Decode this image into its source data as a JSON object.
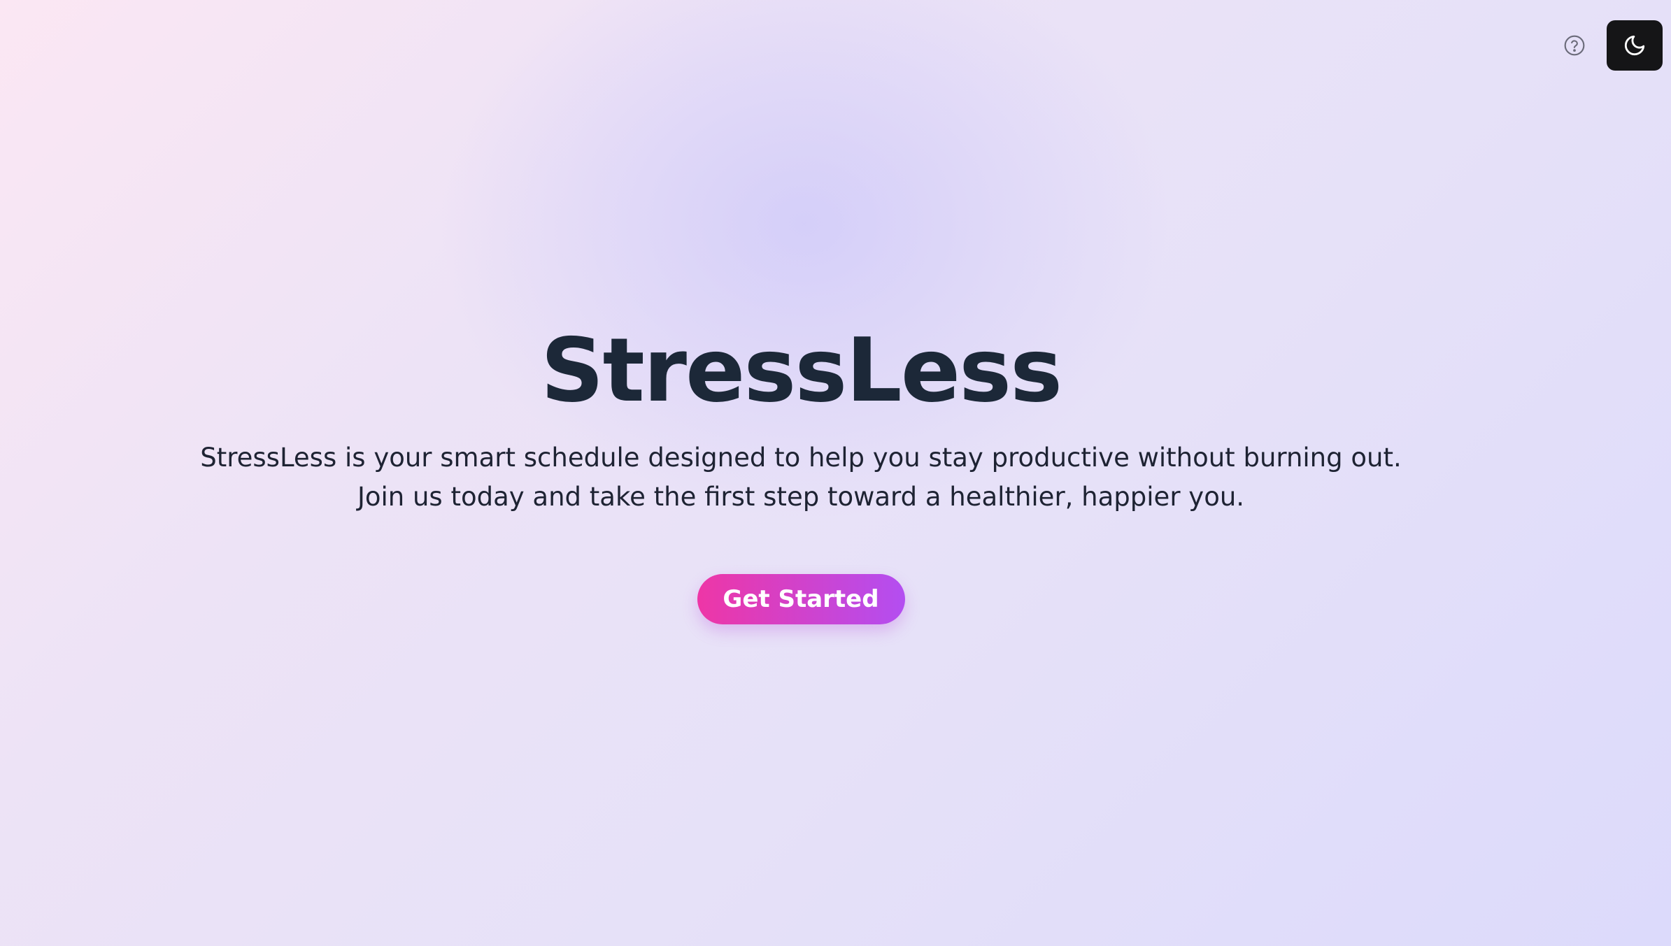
{
  "header": {
    "help_icon": "question-circle-icon",
    "theme_icon": "moon-icon"
  },
  "hero": {
    "title": "StressLess",
    "subtitle_line1": "StressLess is your smart schedule designed to help you stay productive without burning out.",
    "subtitle_line2": "Join us today and take the first step toward a healthier, happier you.",
    "cta_label": "Get Started"
  },
  "colors": {
    "title": "#1c2838",
    "theme_button_bg": "#151517",
    "cta_gradient_start": "#ee36a6",
    "cta_gradient_end": "#b34ef1"
  }
}
